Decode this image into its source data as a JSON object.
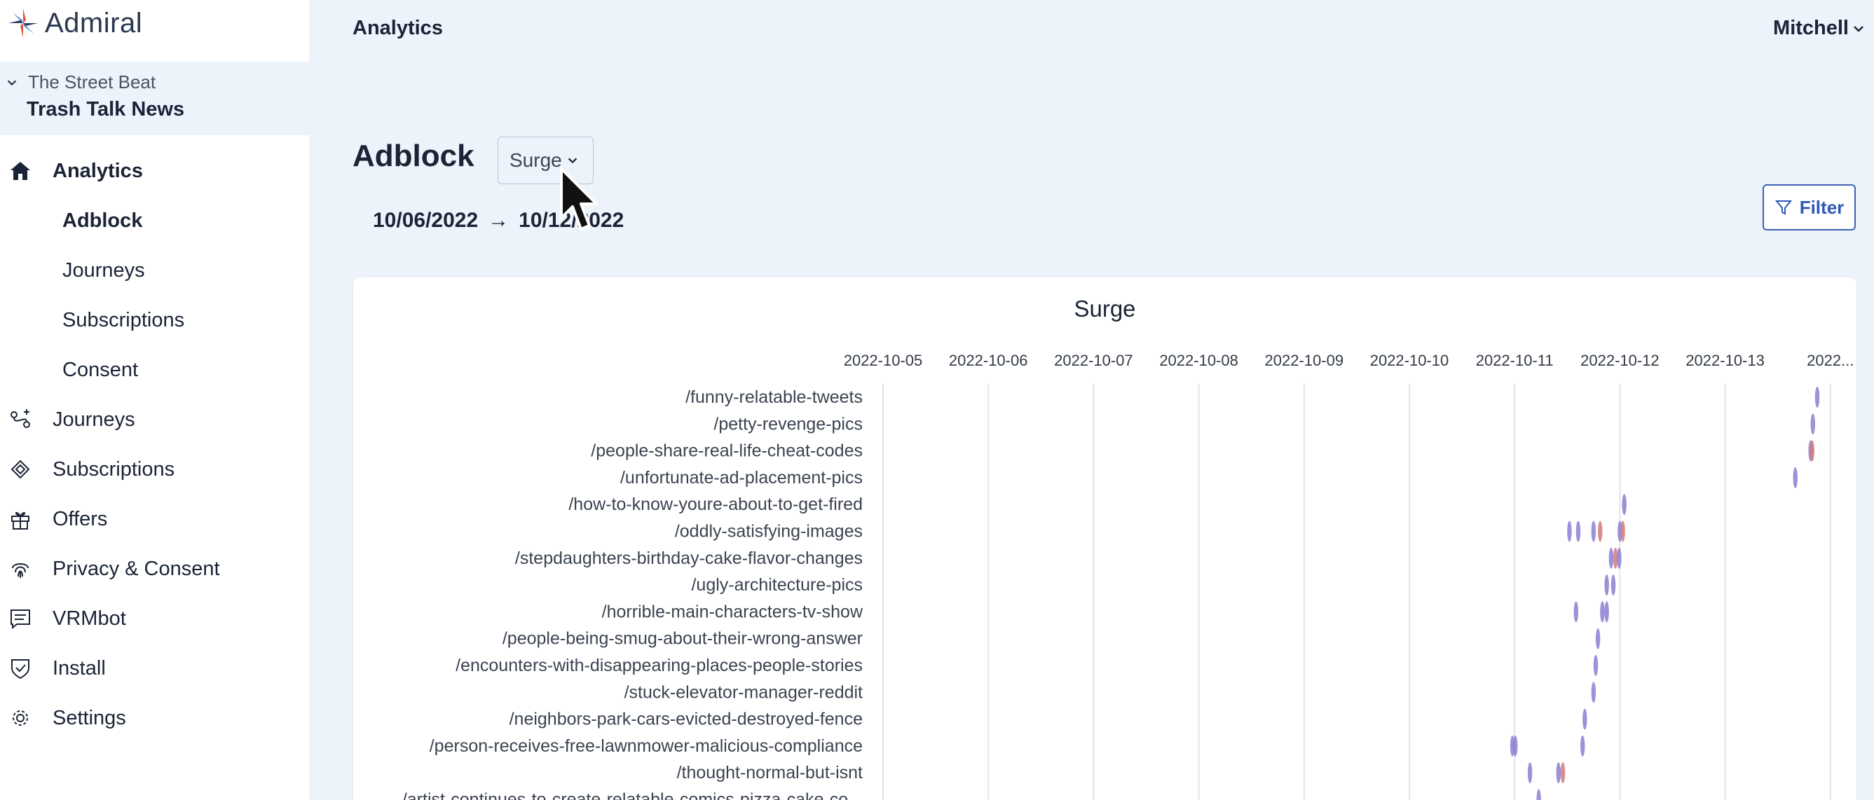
{
  "app": {
    "name": "Admiral"
  },
  "workspace": {
    "parent": "The Street Beat",
    "site": "Trash Talk News"
  },
  "nav": {
    "analytics": "Analytics",
    "analytics_sub": [
      "Adblock",
      "Journeys",
      "Subscriptions",
      "Consent"
    ],
    "journeys": "Journeys",
    "subscriptions": "Subscriptions",
    "offers": "Offers",
    "privacy": "Privacy & Consent",
    "vrmbot": "VRMbot",
    "install": "Install",
    "settings": "Settings"
  },
  "header": {
    "title": "Analytics",
    "user": "Mitchell"
  },
  "page": {
    "title": "Adblock",
    "dropdown_value": "Surge",
    "date_start": "10/06/2022",
    "date_arrow": "→",
    "date_end": "10/12/2022",
    "filter_label": "Filter"
  },
  "colors": {
    "accent": "#2f57b5",
    "mark_purple": "#8a7fd4",
    "mark_red": "#d07a7a"
  },
  "chart_data": {
    "type": "scatter",
    "title": "Surge",
    "x_ticks": [
      "2022-10-05",
      "2022-10-06",
      "2022-10-07",
      "2022-10-08",
      "2022-10-09",
      "2022-10-10",
      "2022-10-11",
      "2022-10-12",
      "2022-10-13",
      "2022..."
    ],
    "categories": [
      "/funny-relatable-tweets",
      "/petty-revenge-pics",
      "/people-share-real-life-cheat-codes",
      "/unfortunate-ad-placement-pics",
      "/how-to-know-youre-about-to-get-fired",
      "/oddly-satisfying-images",
      "/stepdaughters-birthday-cake-flavor-changes",
      "/ugly-architecture-pics",
      "/horrible-main-characters-tv-show",
      "/people-being-smug-about-their-wrong-answer",
      "/encounters-with-disappearing-places-people-stories",
      "/stuck-elevator-manager-reddit",
      "/neighbors-park-cars-evicted-destroyed-fence",
      "/person-receives-free-lawnmower-malicious-compliance",
      "/thought-normal-but-isnt",
      "/artist-continues-to-create-relatable-comics-pizza-cake-co..."
    ],
    "x_range": [
      "2022-10-05",
      "2022-10-14"
    ],
    "grid": true,
    "points": [
      {
        "row": 0,
        "x": "2022-10-13 21:00",
        "color": "purple"
      },
      {
        "row": 1,
        "x": "2022-10-13 20:00",
        "color": "purple"
      },
      {
        "row": 2,
        "x": "2022-10-13 19:30",
        "color": "purple"
      },
      {
        "row": 2,
        "x": "2022-10-13 19:50",
        "color": "red"
      },
      {
        "row": 3,
        "x": "2022-10-13 16:00",
        "color": "purple"
      },
      {
        "row": 4,
        "x": "2022-10-12 01:00",
        "color": "purple"
      },
      {
        "row": 5,
        "x": "2022-10-11 12:30",
        "color": "purple"
      },
      {
        "row": 5,
        "x": "2022-10-11 14:30",
        "color": "purple"
      },
      {
        "row": 5,
        "x": "2022-10-11 18:00",
        "color": "purple"
      },
      {
        "row": 5,
        "x": "2022-10-11 19:30",
        "color": "red"
      },
      {
        "row": 5,
        "x": "2022-10-12 00:00",
        "color": "purple"
      },
      {
        "row": 5,
        "x": "2022-10-12 00:40",
        "color": "red"
      },
      {
        "row": 6,
        "x": "2022-10-11 22:00",
        "color": "purple"
      },
      {
        "row": 6,
        "x": "2022-10-11 23:00",
        "color": "red"
      },
      {
        "row": 6,
        "x": "2022-10-11 23:50",
        "color": "purple"
      },
      {
        "row": 7,
        "x": "2022-10-11 21:00",
        "color": "purple"
      },
      {
        "row": 7,
        "x": "2022-10-11 22:30",
        "color": "purple"
      },
      {
        "row": 8,
        "x": "2022-10-11 14:00",
        "color": "purple"
      },
      {
        "row": 8,
        "x": "2022-10-11 20:00",
        "color": "purple"
      },
      {
        "row": 8,
        "x": "2022-10-11 21:00",
        "color": "purple"
      },
      {
        "row": 9,
        "x": "2022-10-11 19:00",
        "color": "purple"
      },
      {
        "row": 10,
        "x": "2022-10-11 18:30",
        "color": "purple"
      },
      {
        "row": 11,
        "x": "2022-10-11 18:00",
        "color": "purple"
      },
      {
        "row": 12,
        "x": "2022-10-11 16:00",
        "color": "purple"
      },
      {
        "row": 13,
        "x": "2022-10-10 23:30",
        "color": "purple"
      },
      {
        "row": 13,
        "x": "2022-10-11 00:10",
        "color": "purple"
      },
      {
        "row": 13,
        "x": "2022-10-11 15:30",
        "color": "purple"
      },
      {
        "row": 14,
        "x": "2022-10-11 03:30",
        "color": "purple"
      },
      {
        "row": 14,
        "x": "2022-10-11 10:00",
        "color": "purple"
      },
      {
        "row": 14,
        "x": "2022-10-11 11:00",
        "color": "red"
      },
      {
        "row": 15,
        "x": "2022-10-11 05:30",
        "color": "purple"
      }
    ]
  }
}
